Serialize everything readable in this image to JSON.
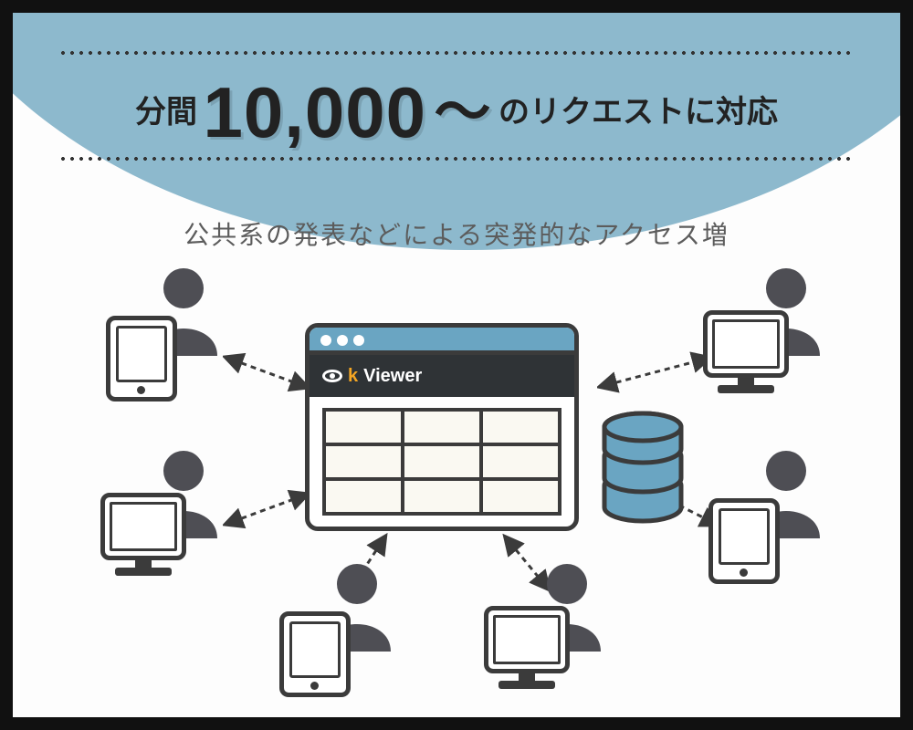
{
  "headline": {
    "prefix": "分間",
    "number": "10,000",
    "tilde": "〜",
    "suffix": "のリクエストに対応"
  },
  "subhead": "公共系の発表などによる突発的なアクセス増",
  "app": {
    "brand_k": "k",
    "brand_rest": "Viewer"
  },
  "users": [
    {
      "pos": "tl",
      "device": "tablet"
    },
    {
      "pos": "tr",
      "device": "monitor"
    },
    {
      "pos": "ml",
      "device": "monitor"
    },
    {
      "pos": "mr",
      "device": "tablet"
    },
    {
      "pos": "bl",
      "device": "tablet"
    },
    {
      "pos": "br",
      "device": "monitor"
    }
  ],
  "colors": {
    "header_bg": "#8db9cd",
    "accent_blue": "#6aa5c2",
    "outline": "#3b3b3b",
    "orange": "#f5a623",
    "person": "#4e4e54"
  }
}
